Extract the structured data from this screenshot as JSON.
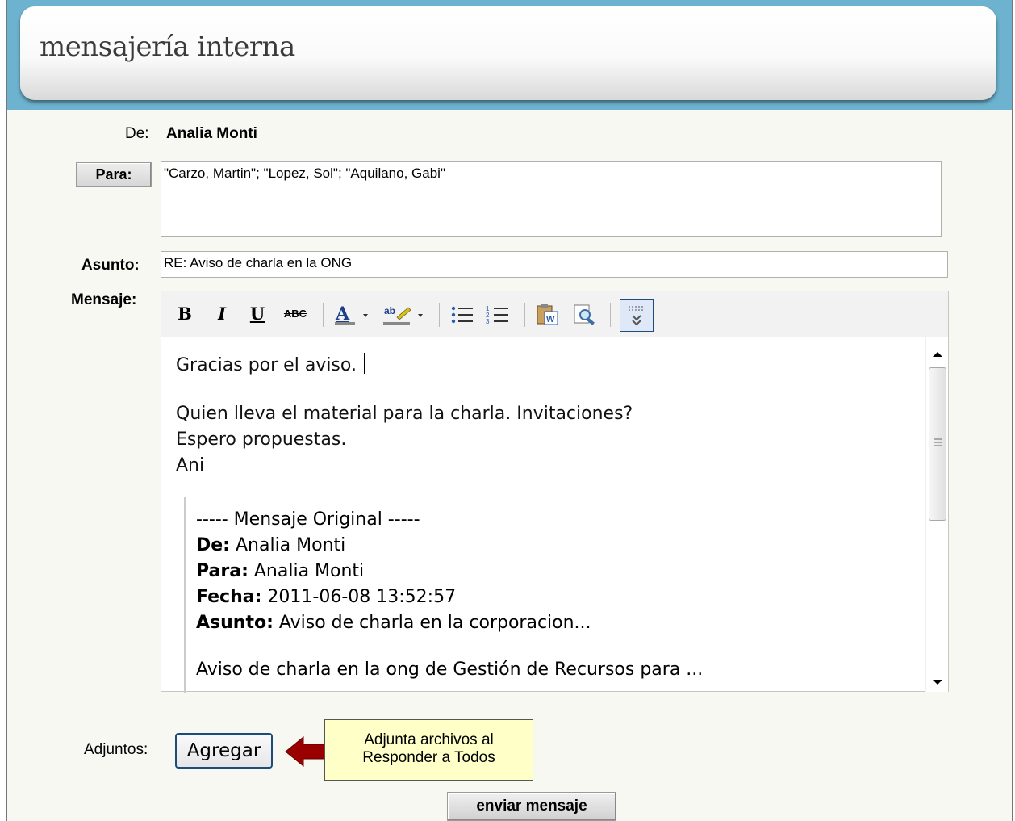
{
  "header": {
    "title": "mensajería interna"
  },
  "form": {
    "from_label": "De:",
    "from_value": "Analia Monti",
    "to_button": "Para:",
    "to_value": "\"Carzo, Martin\"; \"Lopez, Sol\"; \"Aquilano, Gabi\"",
    "subject_label": "Asunto:",
    "subject_value": "RE: Aviso de charla en la ONG",
    "message_label": "Mensaje:"
  },
  "toolbar": {
    "bold": "B",
    "italic": "I",
    "underline": "U",
    "strike": "ABC",
    "icons": [
      "bold-icon",
      "italic-icon",
      "underline-icon",
      "strikethrough-icon",
      "font-color-icon",
      "highlight-color-icon",
      "bullet-list-icon",
      "numbered-list-icon",
      "paste-word-icon",
      "preview-icon",
      "more-tools-icon"
    ]
  },
  "editor": {
    "line1": "Gracias por el aviso.",
    "line2": "Quien lleva el material para la charla. Invitaciones?",
    "line3": "Espero propuestas.",
    "line4": "Ani",
    "quote": {
      "header": "----- Mensaje Original -----",
      "from_label": "De:",
      "from_value": "Analia Monti",
      "to_label": "Para:",
      "to_value": "Analia Monti",
      "date_label": "Fecha:",
      "date_value": "2011-06-08 13:52:57",
      "subject_label": "Asunto:",
      "subject_value": "Aviso de charla en la corporacion...",
      "body": "Aviso de charla en la ong de Gestión de Recursos para ..."
    }
  },
  "attachments": {
    "label": "Adjuntos:",
    "add_button": "Agregar",
    "callout_line1": "Adjunta archivos al",
    "callout_line2": "Responder a Todos"
  },
  "send_button": "enviar mensaje",
  "colors": {
    "header_band": "#6db3cf",
    "callout_bg": "#ffffc8",
    "arrow": "#9b0000",
    "button_border": "#1c4d7a"
  }
}
